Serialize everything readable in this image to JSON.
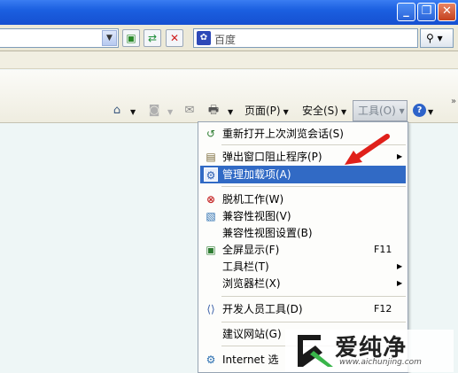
{
  "search": {
    "placeholder": "百度",
    "button_icon": "search-icon"
  },
  "commandbar": {
    "page_label": "页面(P)",
    "safety_label": "安全(S)",
    "tools_label": "工具(O)",
    "home_icon": "home-icon",
    "feeds_icon": "feeds-icon",
    "mail_icon": "mail-icon",
    "print_icon": "print-icon",
    "help_icon": "help-icon"
  },
  "menu": {
    "items": [
      {
        "label": "重新打开上次浏览会话(S)",
        "icon": "reopen-session-icon"
      },
      {
        "label": "弹出窗口阻止程序(P)",
        "icon": "popup-blocker-icon",
        "submenu": true
      },
      {
        "label": "管理加载项(A)",
        "icon": "manage-addons-icon",
        "highlighted": true
      },
      {
        "label": "脱机工作(W)",
        "icon": "work-offline-icon"
      },
      {
        "label": "兼容性视图(V)",
        "icon": "compat-view-icon"
      },
      {
        "label": "兼容性视图设置(B)",
        "icon": ""
      },
      {
        "label": "全屏显示(F)",
        "icon": "fullscreen-icon",
        "shortcut": "F11"
      },
      {
        "label": "工具栏(T)",
        "icon": "",
        "submenu": true
      },
      {
        "label": "浏览器栏(X)",
        "icon": "",
        "submenu": true
      },
      {
        "label": "开发人员工具(D)",
        "icon": "dev-tools-icon",
        "shortcut": "F12"
      },
      {
        "label": "建议网站(G)",
        "icon": ""
      },
      {
        "label": "Internet 选",
        "icon": "internet-options-icon"
      }
    ]
  },
  "watermark": {
    "brand": "爱纯净",
    "url": "www.aichunjing.com"
  },
  "colors": {
    "highlight": "#316ac5",
    "arrow": "#e0201a",
    "titlebar": "#1b5fe0"
  }
}
